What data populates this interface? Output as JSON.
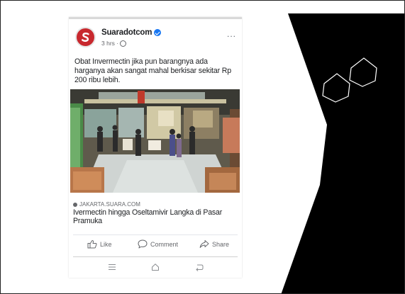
{
  "post": {
    "page_name": "Suaradotcom",
    "time": "3 hrs · ",
    "caption": "Obat Invermectin jika pun barangnya ada harganya akan sangat mahal berkisar sekitar Rp 200 ribu lebih.",
    "more_label": "...",
    "link": {
      "domain": "JAKARTA.SUARA.COM",
      "title": "Ivermectin hingga Oseltamivir Langka di Pasar Pramuka"
    }
  },
  "actions": {
    "like": "Like",
    "comment": "Comment",
    "share": "Share"
  },
  "icons": {
    "avatar": "suara-logo-icon",
    "verified": "verified-badge-icon",
    "audience": "globe-icon",
    "link_source": "globe-icon",
    "like": "thumbs-up-icon",
    "comment": "comment-bubble-icon",
    "share": "share-arrow-icon",
    "nav_menu": "menu-icon",
    "nav_home": "home-icon",
    "nav_back": "back-icon",
    "decoration": "hexagon-outline-icon"
  },
  "colors": {
    "brand_red": "#c8282e",
    "facebook_blue": "#1877f2",
    "text": "#1c1e21",
    "secondary_text": "#65676b",
    "dark_panel": "#000000"
  }
}
